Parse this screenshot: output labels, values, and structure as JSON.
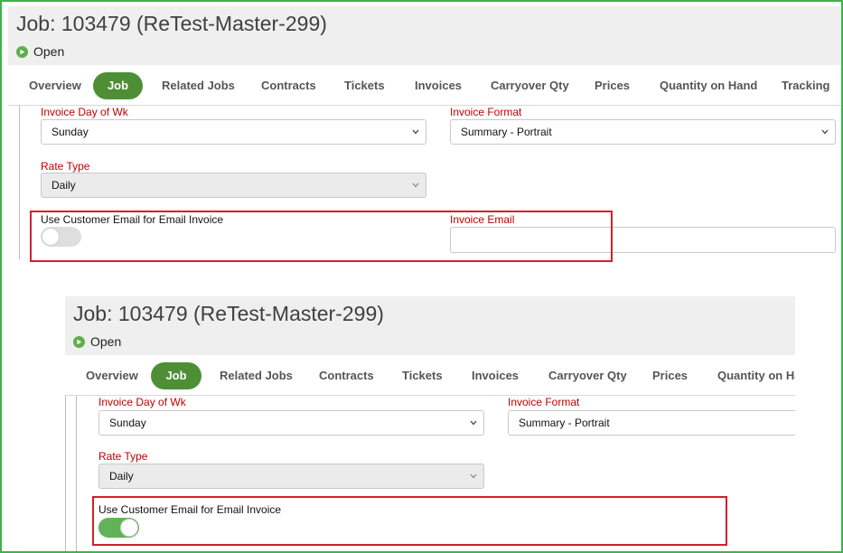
{
  "job": {
    "title": "Job: 103479 (ReTest-Master-299)",
    "status": "Open"
  },
  "tabs": [
    {
      "label": "Overview"
    },
    {
      "label": "Job",
      "active": true
    },
    {
      "label": "Related Jobs"
    },
    {
      "label": "Contracts"
    },
    {
      "label": "Tickets"
    },
    {
      "label": "Invoices"
    },
    {
      "label": "Carryover Qty"
    },
    {
      "label": "Prices"
    },
    {
      "label": "Quantity on Hand"
    },
    {
      "label": "Tracking"
    }
  ],
  "form": {
    "invoice_day_label": "Invoice Day of Wk",
    "invoice_day_value": "Sunday",
    "invoice_format_label": "Invoice Format",
    "invoice_format_value": "Summary - Portrait",
    "rate_type_label": "Rate Type",
    "rate_type_value": "Daily",
    "use_customer_email_label": "Use Customer Email for Email Invoice",
    "invoice_email_label": "Invoice Email",
    "invoice_email_value": ""
  },
  "states": {
    "before": {
      "use_customer_email": false
    },
    "after": {
      "use_customer_email": true
    }
  },
  "colors": {
    "frame_border": "#3db34a",
    "active_tab": "#4e8f35",
    "required_label": "#c00000",
    "highlight_box": "#d0212d",
    "toggle_on": "#62b257"
  }
}
